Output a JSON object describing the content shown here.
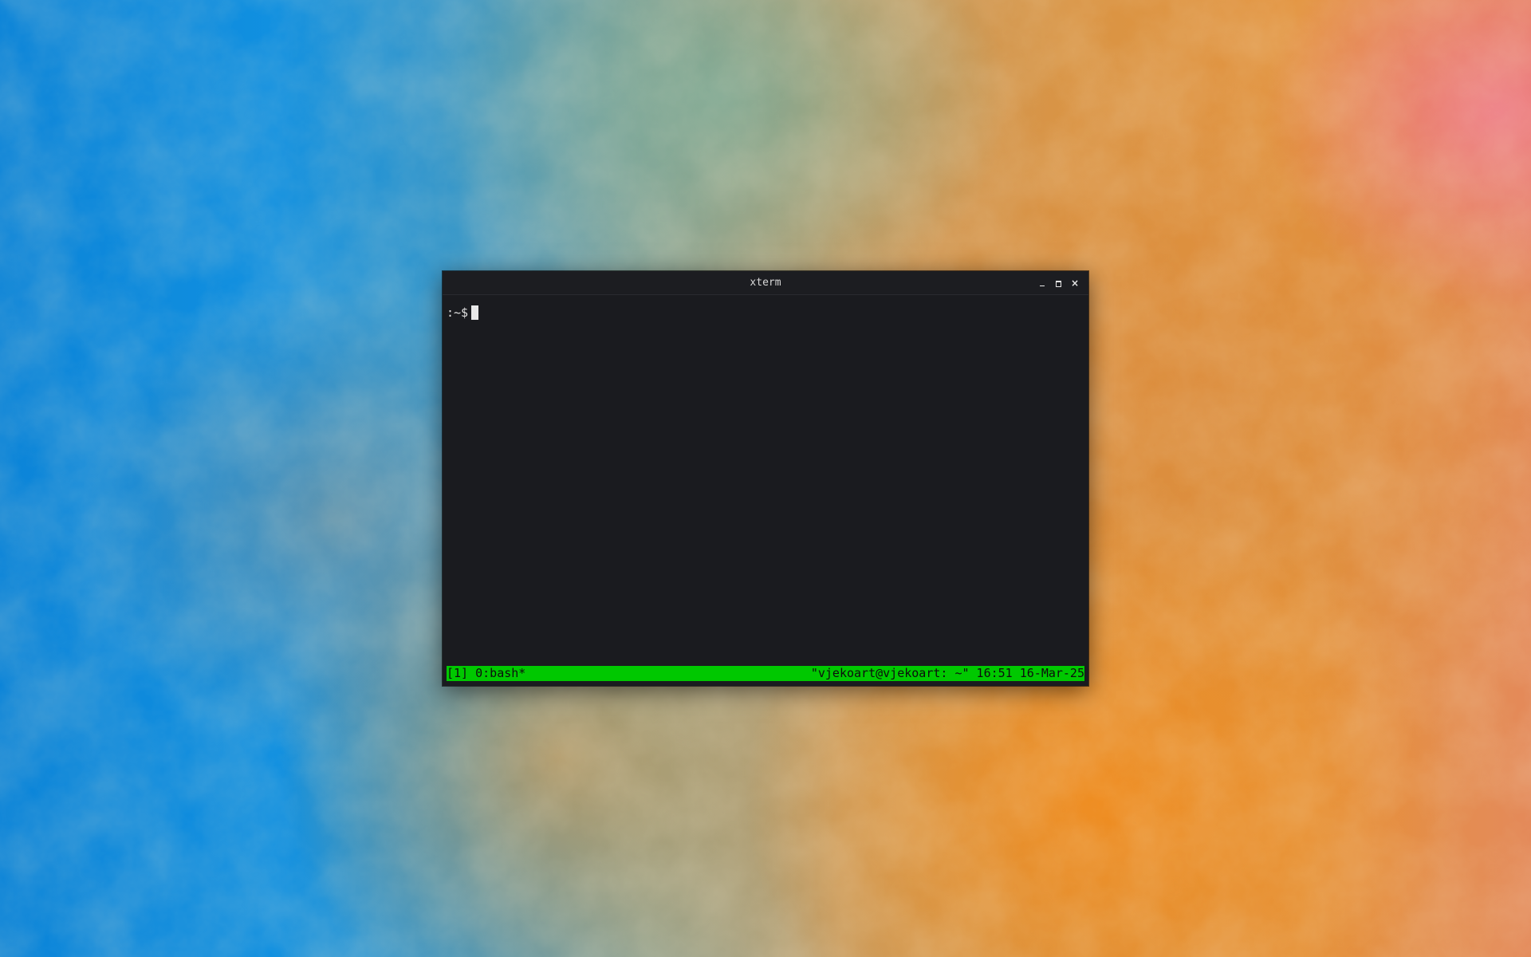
{
  "window": {
    "title": "xterm",
    "controls": {
      "minimize_icon": "minimize-icon",
      "maximize_icon": "maximize-icon",
      "close_label": "×"
    }
  },
  "terminal": {
    "prompt": ":~$"
  },
  "tmux_status": {
    "left": "[1] 0:bash*",
    "right": "\"vjekoart@vjekoart: ~\" 16:51 16-Mar-25",
    "color": "#00c800"
  },
  "colors": {
    "terminal_bg": "#1a1b1f",
    "status_bg": "#00c800"
  }
}
